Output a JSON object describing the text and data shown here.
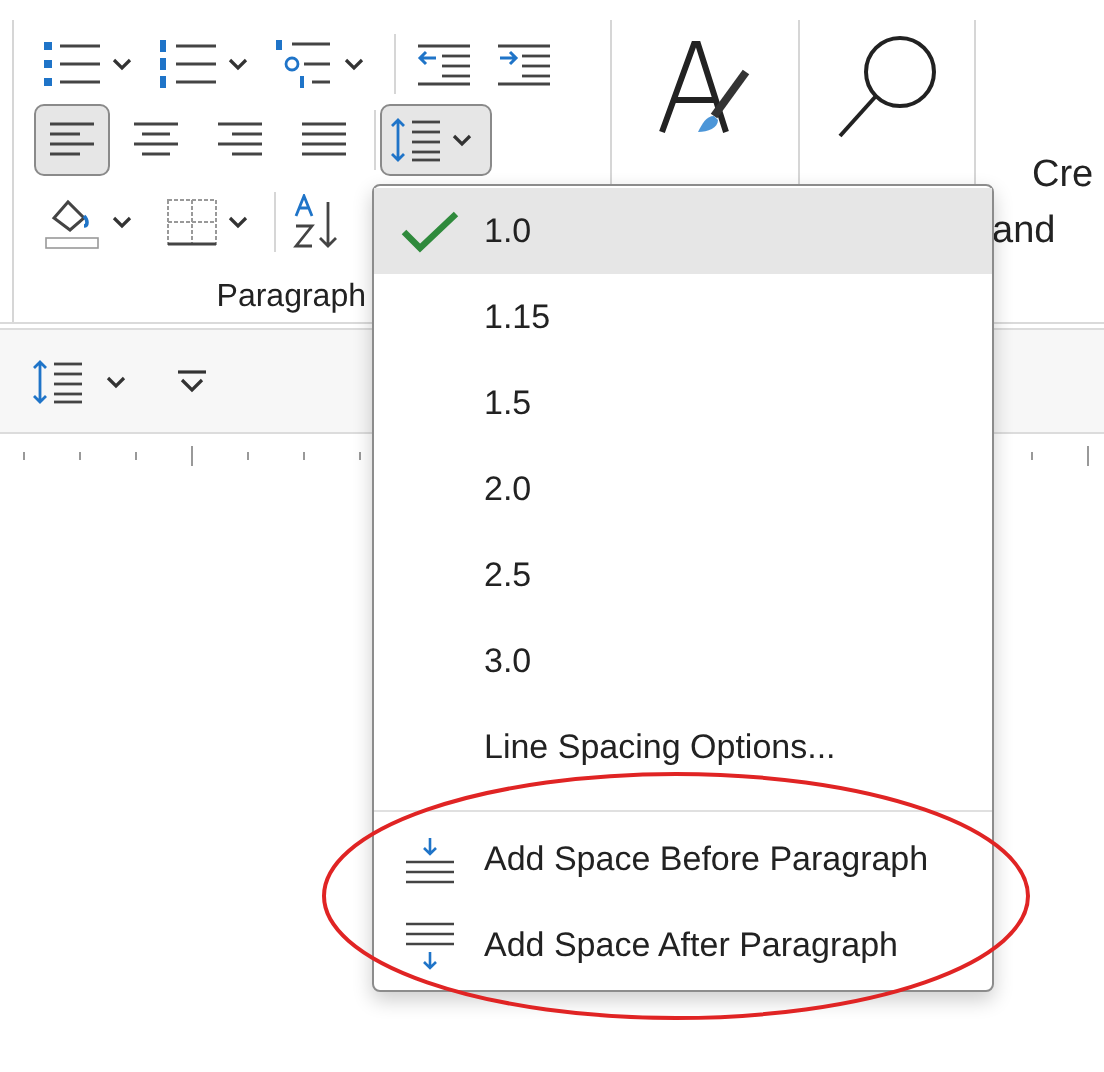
{
  "ribbon": {
    "paragraph_group": {
      "label": "Paragraph",
      "alignment_buttons": [
        {
          "selected": true
        },
        {
          "selected": false
        },
        {
          "selected": false
        },
        {
          "selected": false
        }
      ],
      "line_spacing_button": {
        "expanded": true
      }
    },
    "cut_group": {
      "lines": [
        "Cre",
        "and"
      ]
    }
  },
  "line_spacing_menu": {
    "items": [
      {
        "label": "1.0",
        "kind": "value",
        "checked": true
      },
      {
        "label": "1.15",
        "kind": "value",
        "checked": false
      },
      {
        "label": "1.5",
        "kind": "value",
        "checked": false
      },
      {
        "label": "2.0",
        "kind": "value",
        "checked": false
      },
      {
        "label": "2.5",
        "kind": "value",
        "checked": false
      },
      {
        "label": "3.0",
        "kind": "value",
        "checked": false
      },
      {
        "label": "Line Spacing Options...",
        "kind": "command",
        "checked": false
      },
      {
        "label": "Add Space Before Paragraph",
        "kind": "space-before",
        "checked": false
      },
      {
        "label": "Add Space After Paragraph",
        "kind": "space-after",
        "checked": false
      }
    ]
  },
  "annotation": {
    "kind": "ellipse",
    "color": "#e02424"
  }
}
